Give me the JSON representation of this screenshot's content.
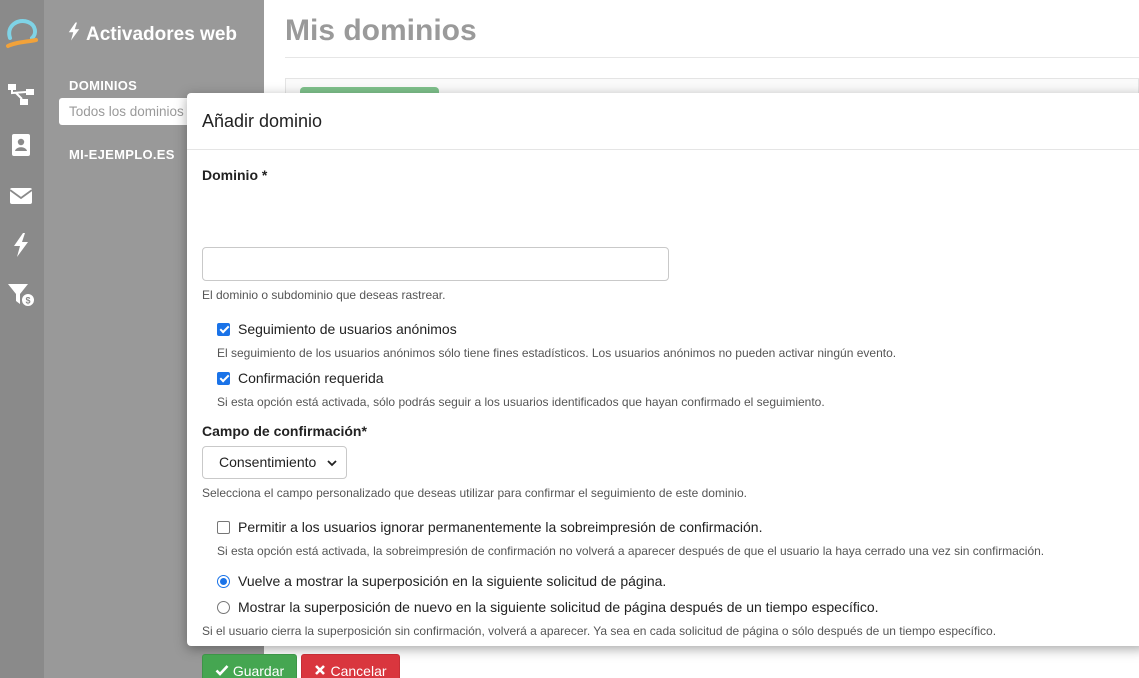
{
  "sidebar": {
    "title": "Activadores web",
    "section_label": "DOMINIOS",
    "active_item": "Todos los dominios",
    "domain_label": "MI-EJEMPLO.ES"
  },
  "main": {
    "title": "Mis dominios"
  },
  "modal": {
    "title": "Añadir dominio",
    "domain": {
      "label": "Dominio *",
      "value": "",
      "placeholder": "",
      "help": "El dominio o subdominio que deseas rastrear."
    },
    "anonymous_tracking": {
      "label": "Seguimiento de usuarios anónimos",
      "checked": true,
      "help": "El seguimiento de los usuarios anónimos sólo tiene fines estadísticos. Los usuarios anónimos no pueden activar ningún evento."
    },
    "confirmation_required": {
      "label": "Confirmación requerida",
      "checked": true,
      "help": "Si esta opción está activada, sólo podrás seguir a los usuarios identificados que hayan confirmado el seguimiento."
    },
    "confirmation_field": {
      "label": "Campo de confirmación*",
      "selected": "Consentimiento",
      "help": "Selecciona el campo personalizado que deseas utilizar para confirmar el seguimiento de este dominio."
    },
    "allow_ignore": {
      "label": "Permitir a los usuarios ignorar permanentemente la sobreimpresión de confirmación.",
      "checked": false,
      "help": "Si esta opción está activada, la sobreimpresión de confirmación no volverá a aparecer después de que el usuario la haya cerrado una vez sin confirmación."
    },
    "overlay_options": [
      {
        "label": "Vuelve a mostrar la superposición en la siguiente solicitud de página.",
        "selected": true
      },
      {
        "label": "Mostrar la superposición de nuevo en la siguiente solicitud de página después de un tiempo específico.",
        "selected": false
      }
    ],
    "overlay_help": "Si el usuario cierra la superposición sin confirmación, volverá a aparecer. Ya sea en cada solicitud de página o sólo después de un tiempo específico.",
    "save_label": "Guardar",
    "cancel_label": "Cancelar"
  },
  "colors": {
    "rail": "#8a8a8a",
    "sidebar": "#999999",
    "save": "#45a651",
    "cancel": "#d9363e",
    "accent": "#1a73e8"
  },
  "icons": [
    "logo-icon",
    "sitemap-icon",
    "contacts-icon",
    "envelope-icon",
    "bolt-icon",
    "funnel-dollar-icon",
    "check-icon",
    "times-icon",
    "chevron-down-icon"
  ]
}
